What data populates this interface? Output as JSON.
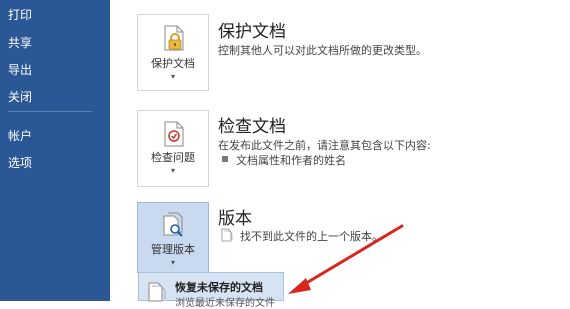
{
  "nav": {
    "items": [
      "打印",
      "共享",
      "导出",
      "关闭",
      "帐户",
      "选项"
    ]
  },
  "protect": {
    "tile_label": "保护文档",
    "title": "保护文档",
    "desc": "控制其他人可以对此文档所做的更改类型。",
    "icon": "lock-key-document-icon"
  },
  "inspect": {
    "tile_label": "检查问题",
    "title": "检查文档",
    "desc": "在发布此文件之前，请注意其包含以下内容:",
    "bullet": "文档属性和作者的姓名",
    "icon": "inspect-check-document-icon"
  },
  "versions": {
    "tile_label": "管理版本",
    "title": "版本",
    "desc": "找不到此文件的上一个版本。",
    "icon": "manage-versions-magnifier-icon"
  },
  "menu": {
    "recover_title": "恢复未保存的文档",
    "recover_sub": "浏览最近未保存的文件",
    "icon": "recover-document-icon"
  },
  "colors": {
    "nav_bg": "#2b5797",
    "accent_red": "#d9261c",
    "highlight": "#c9d9ef"
  }
}
